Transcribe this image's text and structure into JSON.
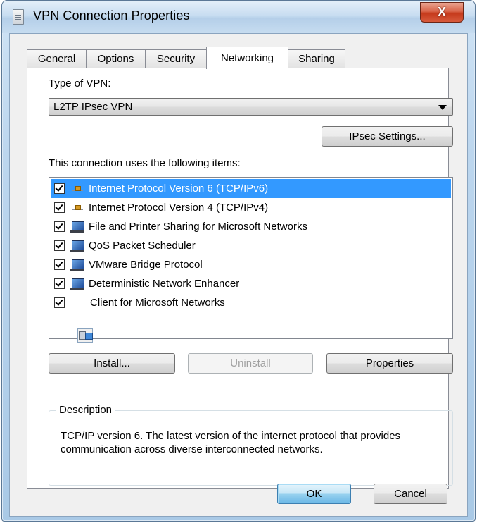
{
  "window": {
    "title": "VPN Connection Properties",
    "close_glyph": "X"
  },
  "tabs": [
    {
      "label": "General",
      "active": false
    },
    {
      "label": "Options",
      "active": false
    },
    {
      "label": "Security",
      "active": false
    },
    {
      "label": "Networking",
      "active": true
    },
    {
      "label": "Sharing",
      "active": false
    }
  ],
  "networking": {
    "vpn_type_label": "Type of VPN:",
    "vpn_type_value": "L2TP IPsec VPN",
    "ipsec_button": "IPsec Settings...",
    "items_label": "This connection uses the following items:",
    "items": [
      {
        "label": "Internet Protocol Version 6 (TCP/IPv6)",
        "checked": true,
        "selected": true,
        "icon": "network-protocol-icon"
      },
      {
        "label": "Internet Protocol Version 4 (TCP/IPv4)",
        "checked": true,
        "selected": false,
        "icon": "network-protocol-icon"
      },
      {
        "label": "File and Printer Sharing for Microsoft Networks",
        "checked": true,
        "selected": false,
        "icon": "network-service-icon"
      },
      {
        "label": "QoS Packet Scheduler",
        "checked": true,
        "selected": false,
        "icon": "network-service-icon"
      },
      {
        "label": "VMware Bridge Protocol",
        "checked": true,
        "selected": false,
        "icon": "network-service-icon"
      },
      {
        "label": "Deterministic Network Enhancer",
        "checked": true,
        "selected": false,
        "icon": "network-service-icon"
      },
      {
        "label": "Client for Microsoft Networks",
        "checked": true,
        "selected": false,
        "icon": "network-client-icon"
      }
    ],
    "install_button": "Install...",
    "uninstall_button": "Uninstall",
    "properties_button": "Properties",
    "description_legend": "Description",
    "description_text": "TCP/IP version 6. The latest version of the internet protocol that provides communication across diverse interconnected networks."
  },
  "footer": {
    "ok_button": "OK",
    "cancel_button": "Cancel"
  },
  "colors": {
    "selection": "#3399ff",
    "close_button": "#c53a1c",
    "focus_button": "#6bb8e6"
  }
}
